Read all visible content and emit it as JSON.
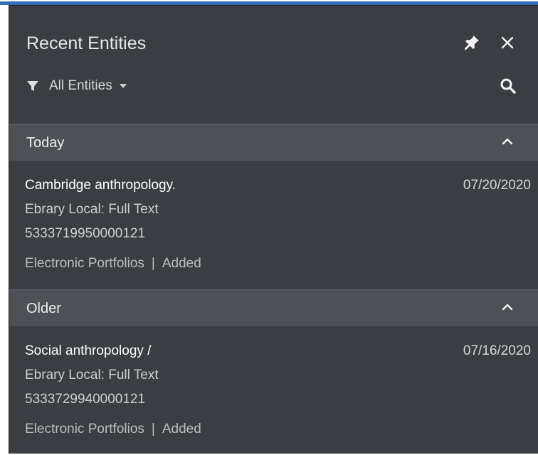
{
  "panel": {
    "title": "Recent Entities",
    "filter_label": "All Entities",
    "icons": {
      "pin": "pin-icon",
      "close": "close-icon",
      "filter": "filter-icon",
      "caret": "caret-down-icon",
      "search": "search-icon",
      "chevron": "chevron-up-icon"
    }
  },
  "groups": [
    {
      "label": "Today",
      "items": [
        {
          "name": "Cambridge anthropology.",
          "date": "07/20/2020",
          "library": "Ebrary Local: Full Text",
          "code": "5333719950000121",
          "type": "Electronic Portfolios",
          "separator": "|",
          "action": "Added"
        }
      ]
    },
    {
      "label": "Older",
      "items": [
        {
          "name": "Social anthropology /",
          "date": "07/16/2020",
          "library": "Ebrary Local: Full Text",
          "code": "5333729940000121",
          "type": "Electronic Portfolios",
          "separator": "|",
          "action": "Added"
        }
      ]
    }
  ],
  "colors": {
    "panel_bg": "#3a3d41",
    "group_header_bg": "#4d5156",
    "accent_strip": "#2f6fb8"
  }
}
